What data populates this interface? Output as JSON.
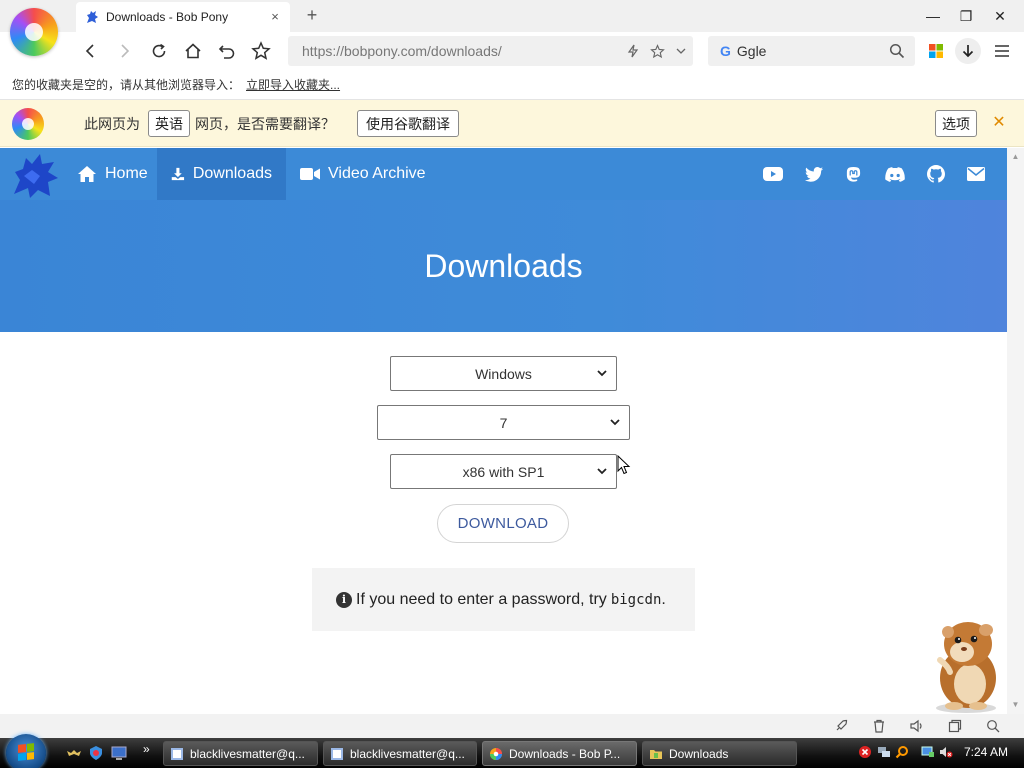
{
  "browser": {
    "tab": {
      "title": "Downloads - Bob Pony",
      "close": "×"
    },
    "new_tab": "+",
    "window_controls": {
      "minimize": "—",
      "maximize": "❐",
      "close": "✕"
    },
    "address": "https://bobpony.com/downloads/",
    "search_engine_letter": "G",
    "search_value": "Ggle",
    "bookmarks": {
      "message": "您的收藏夹是空的，请从其他浏览器导入：",
      "link": "立即导入收藏夹..."
    }
  },
  "translate_bar": {
    "prefix": "此网页为",
    "language": "英语",
    "question": "网页，是否需要翻译？",
    "translate_button": "使用谷歌翻译",
    "options_button": "选项",
    "close": "✕"
  },
  "site": {
    "nav": {
      "home": "Home",
      "downloads": "Downloads",
      "video_archive": "Video Archive"
    },
    "social_icons": [
      "youtube-icon",
      "twitter-icon",
      "mastodon-icon",
      "discord-icon",
      "github-icon",
      "mail-icon"
    ],
    "hero_title": "Downloads",
    "selects": {
      "os": "Windows",
      "version": "7",
      "edition": "x86 with SP1"
    },
    "download_button": "DOWNLOAD",
    "notice": {
      "text": "If you need to enter a password, try",
      "password": "bigcdn",
      "suffix": "."
    }
  },
  "taskbar": {
    "items": [
      {
        "label": "blacklivesmatter@q...",
        "active": false
      },
      {
        "label": "blacklivesmatter@q...",
        "active": false
      },
      {
        "label": "Downloads - Bob P...",
        "active": true
      },
      {
        "label": "Downloads",
        "active": false
      }
    ],
    "chevron": "»",
    "clock": "7:24 AM"
  },
  "colors": {
    "site_nav": "#3c8ad7",
    "site_nav_active": "#3179c7",
    "hero_gradient_start": "#3a85d6",
    "hero_gradient_end": "#4f84dc",
    "translate_bar_bg": "#fdf7dc",
    "download_text": "#3d5a9e"
  }
}
